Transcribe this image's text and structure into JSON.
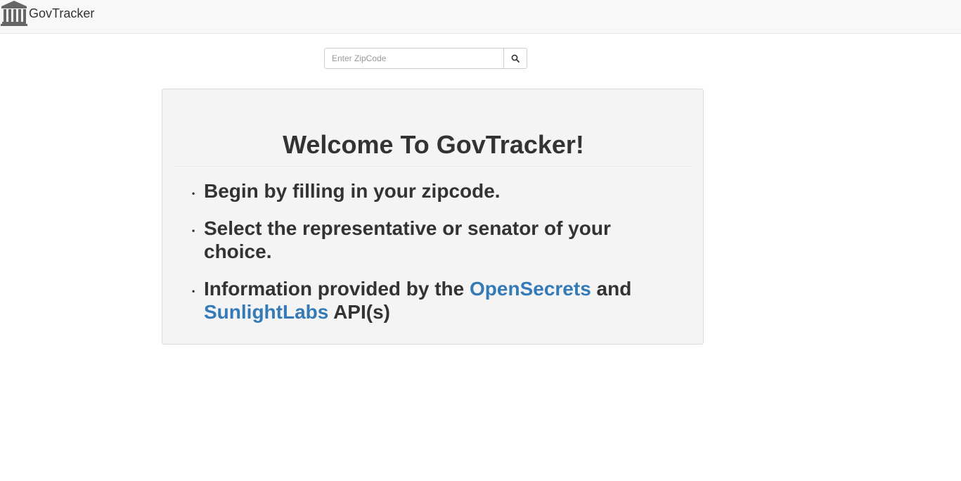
{
  "navbar": {
    "brand": "GovTracker",
    "logo_icon": "capitol-building-icon"
  },
  "search": {
    "placeholder": "Enter ZipCode",
    "value": "",
    "button_icon": "search-icon"
  },
  "welcome": {
    "title": "Welcome To GovTracker!",
    "items": [
      {
        "text": "Begin by filling in your zipcode."
      },
      {
        "text": "Select the representative or senator of your choice."
      },
      {
        "prefix": "Information provided by the ",
        "link1": "OpenSecrets",
        "middle": " and ",
        "link2": "SunlightLabs",
        "suffix": " API(s)"
      }
    ]
  },
  "colors": {
    "link": "#337ab7",
    "navbar_bg": "#f8f8f8",
    "jumbotron_bg": "#f4f4f4",
    "text": "#333333"
  }
}
